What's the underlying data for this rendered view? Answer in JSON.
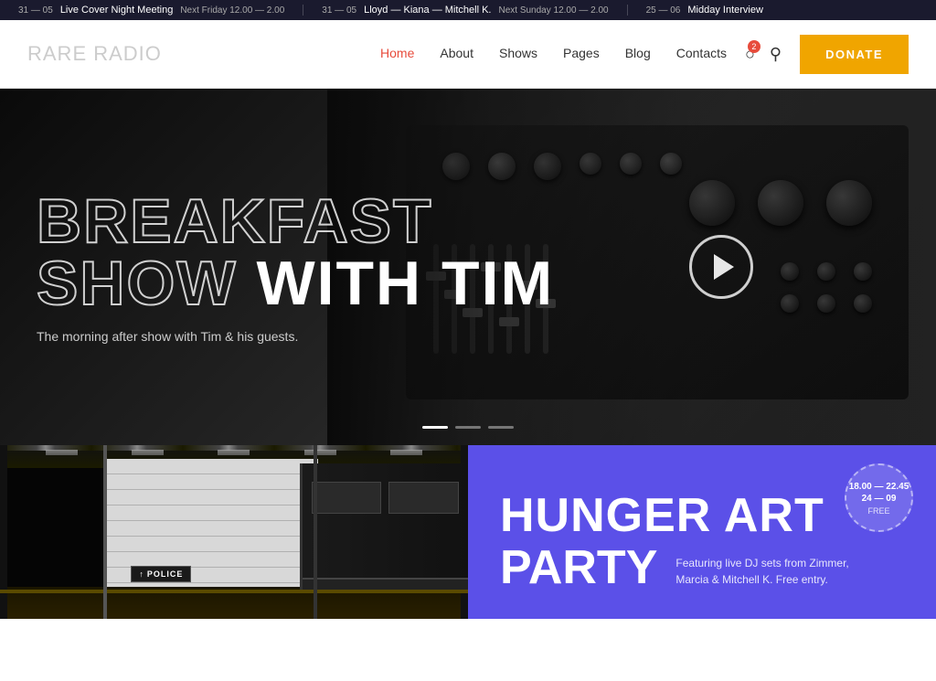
{
  "ticker": {
    "items": [
      {
        "date": "31 — 05",
        "title": "Live Cover Night Meeting",
        "time": "Next Friday 12.00 — 2.00"
      },
      {
        "date": "31 — 05",
        "title": "Lloyd — Kiana — Mitchell K.",
        "time": "Next Sunday 12.00 — 2.00"
      },
      {
        "date": "25 — 06",
        "title": "Midday Interview",
        "time": ""
      }
    ]
  },
  "header": {
    "logo_bold": "RARE",
    "logo_light": " RADIO",
    "nav": [
      {
        "label": "Home",
        "active": true
      },
      {
        "label": "About",
        "active": false
      },
      {
        "label": "Shows",
        "active": false
      },
      {
        "label": "Pages",
        "active": false
      },
      {
        "label": "Blog",
        "active": false
      },
      {
        "label": "Contacts",
        "active": false
      }
    ],
    "cart_badge": "2",
    "donate_label": "DONATE"
  },
  "hero": {
    "title_outline": "BREAKFAST\nSHOW",
    "title_solid": " WITH TIM",
    "subtitle": "The morning after show with Tim & his guests.",
    "slider_dots": [
      true,
      false,
      false
    ]
  },
  "event": {
    "badge_time": "18.00 — 22.45",
    "badge_date": "24 — 09",
    "badge_free": "FREE",
    "title_line1": "HUNGER ART",
    "title_line2": "PARTY",
    "description": "Featuring live DJ sets from Zimmer, Marcia & Mitchell K. Free entry."
  },
  "police_sign": {
    "arrow": "↑",
    "label": "POLICE"
  }
}
